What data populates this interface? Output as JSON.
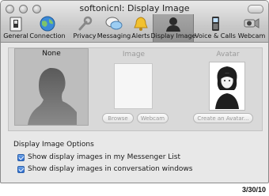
{
  "window": {
    "title": "softonicnl: Display Image"
  },
  "toolbar": {
    "items": [
      {
        "label": "General",
        "icon": "general-switch-icon"
      },
      {
        "label": "Connection",
        "icon": "globe-icon"
      },
      {
        "label": "Privacy",
        "icon": "wrench-icon"
      },
      {
        "label": "Messaging",
        "icon": "speech-bubbles-icon"
      },
      {
        "label": "Alerts",
        "icon": "bell-icon"
      },
      {
        "label": "Display Image",
        "icon": "person-silhouette-icon",
        "selected": true
      },
      {
        "label": "Voice & Calls",
        "icon": "phone-icon"
      },
      {
        "label": "Webcam",
        "icon": "webcam-icon"
      }
    ]
  },
  "images": {
    "none_label": "None",
    "image_label": "Image",
    "avatar_label": "Avatar",
    "browse_button": "Browse",
    "webcam_button": "Webcam",
    "create_avatar_button": "Create an Avatar..."
  },
  "options": {
    "title": "Display Image Options",
    "show_in_list": "Show display images in my Messenger List",
    "show_in_conversation": "Show display images in conversation windows",
    "show_in_list_checked": true,
    "show_in_conversation_checked": true
  },
  "footer": {
    "date": "3/30/10"
  },
  "colors": {
    "checkbox": "#2d6dd0",
    "selected_tab": "#9a9a9a"
  }
}
